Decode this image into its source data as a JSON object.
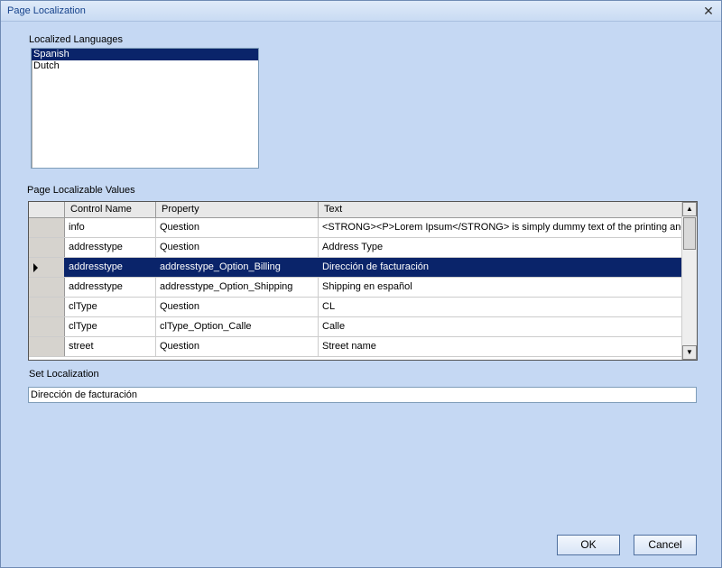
{
  "window": {
    "title": "Page Localization",
    "close_glyph": "✕"
  },
  "languages": {
    "label": "Localized Languages",
    "items": [
      {
        "label": "Spanish",
        "selected": true
      },
      {
        "label": "Dutch",
        "selected": false
      }
    ]
  },
  "values": {
    "label": "Page Localizable Values",
    "columns": [
      "Control Name",
      "Property",
      "Text"
    ],
    "rows": [
      {
        "control": "info",
        "property": "Question",
        "text": "<STRONG><P>Lorem Ipsum</STRONG> is simply dummy text of the printing and..."
      },
      {
        "control": "addresstype",
        "property": "Question",
        "text": "Address Type"
      },
      {
        "control": "addresstype",
        "property": "addresstype_Option_Billing",
        "text": "Dirección de facturación",
        "selected": true
      },
      {
        "control": "addresstype",
        "property": "addresstype_Option_Shipping",
        "text": "Shipping en español"
      },
      {
        "control": "clType",
        "property": "Question",
        "text": "CL"
      },
      {
        "control": "clType",
        "property": "clType_Option_Calle",
        "text": "Calle"
      },
      {
        "control": "street",
        "property": "Question",
        "text": "Street name"
      }
    ]
  },
  "set_localization": {
    "label": "Set Localization",
    "value": "Dirección de facturación"
  },
  "buttons": {
    "ok": "OK",
    "cancel": "Cancel"
  },
  "colors": {
    "background": "#c5d8f3",
    "selection": "#0a246a",
    "title_text": "#15428b"
  }
}
